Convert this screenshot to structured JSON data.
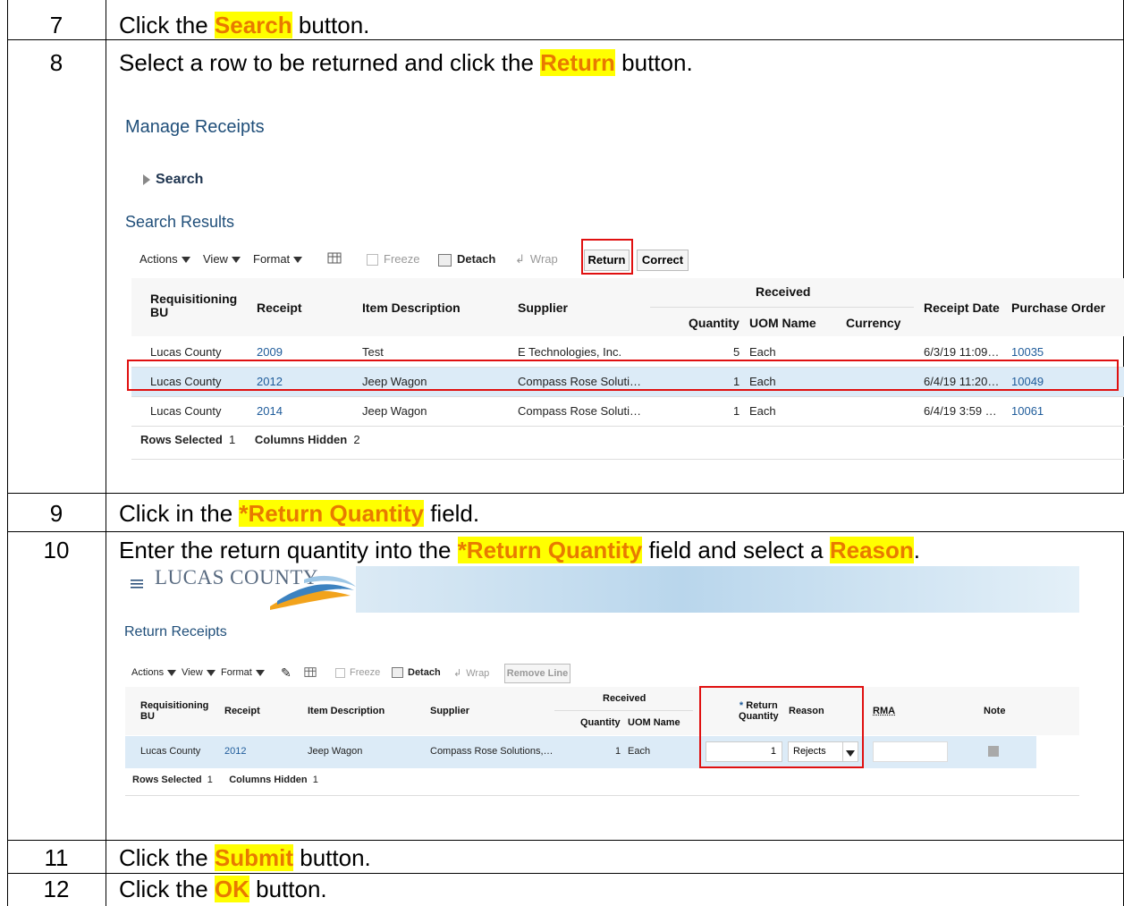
{
  "steps": [
    {
      "num": "7",
      "pre": "Click the ",
      "hl": "Search",
      "post": " button."
    },
    {
      "num": "8",
      "pre": "Select a row to be returned and click the ",
      "hl": "Return",
      "post": " button."
    },
    {
      "num": "9",
      "pre": "Click in the ",
      "hl": "*Return Quantity",
      "post": " field."
    },
    {
      "num": "10",
      "pre": "Enter the return quantity into the ",
      "hl": "*Return Quantity",
      "mid": " field and select a ",
      "hl2": "Reason",
      "post": "."
    },
    {
      "num": "11",
      "pre": "Click the ",
      "hl": "Submit",
      "post": " button."
    },
    {
      "num": "12",
      "pre": "Click the ",
      "hl": "OK",
      "post": " button."
    }
  ],
  "manage": {
    "title": "Manage Receipts",
    "search": "Search",
    "results_title": "Search Results",
    "toolbar": {
      "actions": "Actions",
      "view": "View",
      "format": "Format",
      "freeze": "Freeze",
      "detach": "Detach",
      "wrap": "Wrap",
      "return": "Return",
      "correct": "Correct"
    },
    "headers": {
      "req_bu": "Requisitioning",
      "req_bu2": "BU",
      "receipt": "Receipt",
      "item": "Item Description",
      "supplier": "Supplier",
      "received": "Received",
      "quantity": "Quantity",
      "uom": "UOM Name",
      "currency": "Currency",
      "receipt_date": "Receipt Date",
      "po": "Purchase Order"
    },
    "rows": [
      {
        "bu": "Lucas County",
        "receipt": "2009",
        "item": "Test",
        "supplier": "E Technologies, Inc.",
        "qty": "5",
        "uom": "Each",
        "date": "6/3/19 11:09…",
        "po": "10035"
      },
      {
        "bu": "Lucas County",
        "receipt": "2012",
        "item": "Jeep Wagon",
        "supplier": "Compass Rose Soluti…",
        "qty": "1",
        "uom": "Each",
        "date": "6/4/19 11:20…",
        "po": "10049"
      },
      {
        "bu": "Lucas County",
        "receipt": "2014",
        "item": "Jeep Wagon",
        "supplier": "Compass Rose Soluti…",
        "qty": "1",
        "uom": "Each",
        "date": "6/4/19 3:59 …",
        "po": "10061"
      }
    ],
    "footer_rows_label": "Rows Selected",
    "footer_rows_val": "1",
    "footer_cols_label": "Columns Hidden",
    "footer_cols_val": "2"
  },
  "returns": {
    "brand": "LUCAS COUNTY",
    "title": "Return Receipts",
    "toolbar": {
      "actions": "Actions",
      "view": "View",
      "format": "Format",
      "freeze": "Freeze",
      "detach": "Detach",
      "wrap": "Wrap",
      "remove": "Remove Line"
    },
    "headers": {
      "req_bu": "Requisitioning",
      "req_bu2": "BU",
      "receipt": "Receipt",
      "item": "Item Description",
      "supplier": "Supplier",
      "received": "Received",
      "quantity": "Quantity",
      "uom": "UOM Name",
      "ret_star": "*",
      "ret_qty": "Return",
      "ret_qty2": "Quantity",
      "reason": "Reason",
      "rma": "RMA",
      "note": "Note"
    },
    "row": {
      "bu": "Lucas County",
      "receipt": "2012",
      "item": "Jeep Wagon",
      "supplier": "Compass Rose Solutions,…",
      "qty": "1",
      "uom": "Each",
      "ret_qty": "1",
      "reason": "Rejects"
    },
    "footer_rows_label": "Rows Selected",
    "footer_rows_val": "1",
    "footer_cols_label": "Columns Hidden",
    "footer_cols_val": "1"
  }
}
